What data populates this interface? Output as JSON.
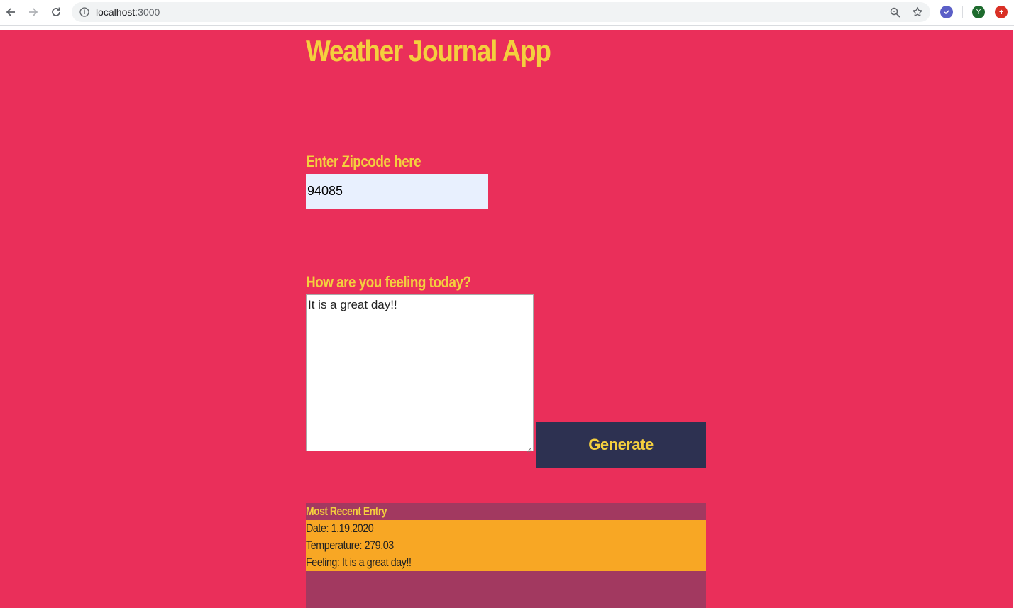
{
  "browser": {
    "url_host": "localhost",
    "url_port": ":3000",
    "profile_initial": "Y",
    "colors": {
      "profile_avatar": "#1e6b2e",
      "extension_1": "#5b5fc7",
      "extension_2": "#d93025"
    }
  },
  "page": {
    "title": "Weather Journal App",
    "zip": {
      "label": "Enter Zipcode here",
      "value": "94085"
    },
    "feelings": {
      "label": "How are you feeling today?",
      "value": "It is a great day!!"
    },
    "generate_label": "Generate",
    "entry": {
      "title": "Most Recent Entry",
      "date": "Date: 1.19.2020",
      "temp": "Temperature: 279.03",
      "content": "Feeling: It is a great day!!"
    },
    "colors": {
      "background": "#ea2f5a",
      "accent": "#f4cf3e",
      "button": "#2d3151",
      "entry_bg": "#a23960",
      "entry_holder": "#f8a724"
    }
  }
}
